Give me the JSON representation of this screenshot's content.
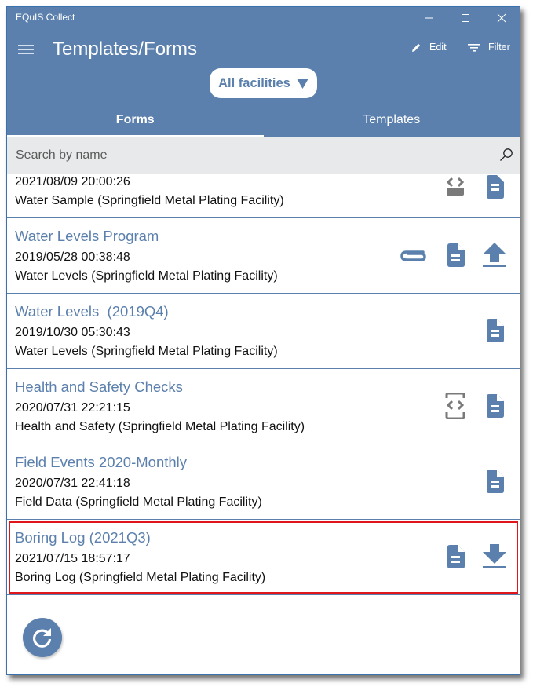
{
  "window": {
    "app_title": "EQuIS Collect",
    "controls": [
      "minimize",
      "maximize",
      "close"
    ]
  },
  "header": {
    "page_title": "Templates/Forms",
    "menu_icon": "hamburger-menu-icon",
    "edit_label": "Edit",
    "filter_label": "Filter"
  },
  "facility_select": {
    "value": "All facilities"
  },
  "tabs": [
    {
      "label": "Forms",
      "active": true
    },
    {
      "label": "Templates",
      "active": false
    }
  ],
  "search": {
    "placeholder": "Search by name",
    "value": ""
  },
  "forms": [
    {
      "name": "",
      "date": "2021/08/09 20:00:26",
      "type": "Water Sample (Springfield Metal Plating Facility)",
      "icons": [
        "code-tray-icon",
        "document-icon"
      ],
      "partial": true
    },
    {
      "name": "Water Levels Program",
      "date": "2019/05/28 00:38:48",
      "type": "Water Levels (Springfield Metal Plating Facility)",
      "icons": [
        "attachment-icon",
        "document-icon",
        "upload-icon"
      ]
    },
    {
      "name": "Water Levels  (2019Q4)",
      "date": "2019/10/30 05:30:43",
      "type": "Water Levels (Springfield Metal Plating Facility)",
      "icons": [
        "document-icon"
      ]
    },
    {
      "name": "Health and Safety Checks",
      "date": "2020/07/31 22:21:15",
      "type": "Health and Safety (Springfield Metal Plating Facility)",
      "icons": [
        "code-tray-icon",
        "document-icon"
      ]
    },
    {
      "name": "Field Events 2020-Monthly",
      "date": "2020/07/31 22:41:18",
      "type": "Field Data (Springfield Metal Plating Facility)",
      "icons": [
        "document-icon"
      ]
    },
    {
      "name": "Boring Log (2021Q3)",
      "date": "2021/07/15 18:57:17",
      "type": "Boring Log (Springfield Metal Plating Facility)",
      "icons": [
        "document-icon",
        "download-icon"
      ],
      "highlighted": true
    }
  ],
  "refresh_button": {
    "icon": "refresh-icon"
  },
  "colors": {
    "accent": "#5b80ad",
    "header_bg": "#5b80ad",
    "search_bg": "#e8e9ea",
    "gray_icon": "#7a7a7a",
    "highlight_border": "#e0161d"
  }
}
